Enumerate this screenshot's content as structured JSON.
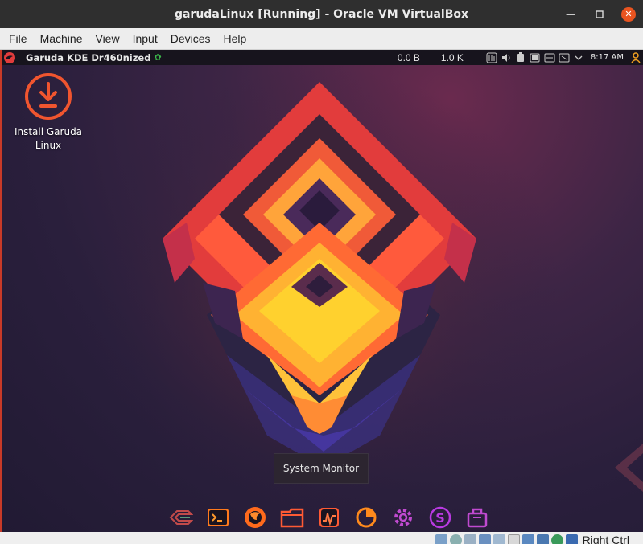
{
  "window": {
    "title": "garudaLinux [Running] - Oracle VM VirtualBox",
    "controls": [
      "minimize-icon",
      "maximize-icon",
      "close-icon"
    ]
  },
  "menubar": {
    "items": [
      "File",
      "Machine",
      "View",
      "Input",
      "Devices",
      "Help"
    ]
  },
  "guest_panel": {
    "title": "Garuda KDE Dr460nized",
    "net_down": "0.0 B",
    "net_up": "1.0 K",
    "time": "8:17 AM",
    "tray_icons": [
      "equalizer-icon",
      "volume-icon",
      "clipboard-icon",
      "battery-icon",
      "printer-icon",
      "network-icon",
      "chevron-down-icon",
      "user-icon"
    ]
  },
  "desktop": {
    "icon_label": "Install Garuda Linux",
    "accent": "#f0552f"
  },
  "tooltip": {
    "text": "System Monitor"
  },
  "dock": {
    "items": [
      "garuda-logo-icon",
      "terminal-icon",
      "firefox-icon",
      "folder-icon",
      "system-monitor-icon",
      "disk-usage-icon",
      "settings-gear-icon",
      "setup-assistant-icon",
      "package-manager-icon"
    ]
  },
  "statusbar": {
    "host_key": "Right Ctrl",
    "icons": [
      "hard-disk-icon",
      "optical-drive-icon",
      "audio-icon",
      "network-adapter-icon",
      "usb-icon",
      "shared-folders-icon",
      "display-icon",
      "recording-icon",
      "mouse-integration-icon",
      "keyboard-capture-icon"
    ]
  }
}
